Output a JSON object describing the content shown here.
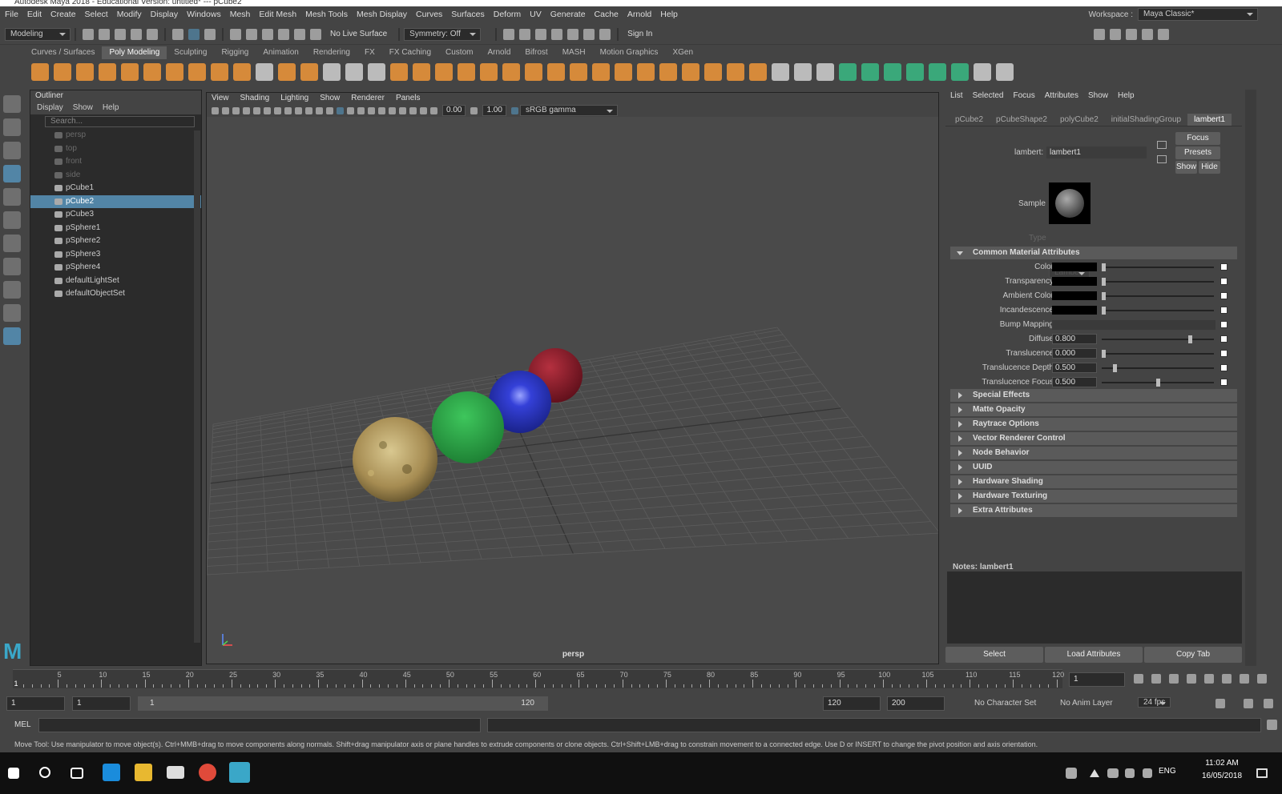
{
  "window": {
    "title": "Autodesk Maya 2018 - Educational Version: untitled*   ---   pCube2"
  },
  "menubar": [
    "File",
    "Edit",
    "Create",
    "Select",
    "Modify",
    "Display",
    "Windows",
    "Mesh",
    "Edit Mesh",
    "Mesh Tools",
    "Mesh Display",
    "Curves",
    "Surfaces",
    "Deform",
    "UV",
    "Generate",
    "Cache",
    "Arnold",
    "Help"
  ],
  "workspace": {
    "label": "Workspace :",
    "value": "Maya Classic*"
  },
  "statusline": {
    "mode": "Modeling",
    "live_surface": "No Live Surface",
    "symmetry": "Symmetry: Off",
    "sign_in": "Sign In"
  },
  "shelf": {
    "tabs": [
      "Curves / Surfaces",
      "Poly Modeling",
      "Sculpting",
      "Rigging",
      "Animation",
      "Rendering",
      "FX",
      "FX Caching",
      "Custom",
      "Arnold",
      "Bifrost",
      "MASH",
      "Motion Graphics",
      "XGen"
    ],
    "active": "Poly Modeling"
  },
  "outliner": {
    "title": "Outliner",
    "menu": [
      "Display",
      "Show",
      "Help"
    ],
    "search_placeholder": "Search...",
    "items": [
      {
        "label": "persp",
        "dim": true
      },
      {
        "label": "top",
        "dim": true
      },
      {
        "label": "front",
        "dim": true
      },
      {
        "label": "side",
        "dim": true
      },
      {
        "label": "pCube1"
      },
      {
        "label": "pCube2",
        "selected": true
      },
      {
        "label": "pCube3"
      },
      {
        "label": "pSphere1"
      },
      {
        "label": "pSphere2"
      },
      {
        "label": "pSphere3"
      },
      {
        "label": "pSphere4"
      },
      {
        "label": "defaultLightSet"
      },
      {
        "label": "defaultObjectSet"
      }
    ]
  },
  "viewport": {
    "menu": [
      "View",
      "Shading",
      "Lighting",
      "Show",
      "Renderer",
      "Panels"
    ],
    "exposure": "0.00",
    "gamma": "1.00",
    "colorspace": "sRGB gamma",
    "camera": "persp"
  },
  "attribute_editor": {
    "menu": [
      "List",
      "Selected",
      "Focus",
      "Attributes",
      "Show",
      "Help"
    ],
    "tabs": [
      "pCube2",
      "pCubeShape2",
      "polyCube2",
      "initialShadingGroup",
      "lambert1"
    ],
    "active_tab": "lambert1",
    "node_label": "lambert:",
    "node_value": "lambert1",
    "buttons": {
      "focus": "Focus",
      "presets": "Presets",
      "show": "Show",
      "hide": "Hide"
    },
    "sample_label": "Sample",
    "type_label": "Type",
    "type_value": "Lambert",
    "common_section": "Common Material Attributes",
    "attributes": [
      {
        "label": "Color",
        "kind": "swatch",
        "slider": 0.0
      },
      {
        "label": "Transparency",
        "kind": "swatch",
        "slider": 0.0
      },
      {
        "label": "Ambient Color",
        "kind": "swatch",
        "slider": 0.0
      },
      {
        "label": "Incandescence",
        "kind": "swatch",
        "slider": 0.0
      },
      {
        "label": "Bump Mapping",
        "kind": "map"
      },
      {
        "label": "Diffuse",
        "kind": "value",
        "value": "0.800",
        "slider": 0.8
      },
      {
        "label": "Translucence",
        "kind": "value",
        "value": "0.000",
        "slider": 0.0
      },
      {
        "label": "Translucence Depth",
        "kind": "value",
        "value": "0.500",
        "slider": 0.1
      },
      {
        "label": "Translucence Focus",
        "kind": "value",
        "value": "0.500",
        "slider": 0.5
      }
    ],
    "sections": [
      "Special Effects",
      "Matte Opacity",
      "Raytrace Options",
      "Vector Renderer Control",
      "Node Behavior",
      "UUID",
      "Hardware Shading",
      "Hardware Texturing",
      "Extra Attributes"
    ],
    "notes_label": "Notes:  lambert1",
    "bottom_buttons": [
      "Select",
      "Load Attributes",
      "Copy Tab"
    ]
  },
  "timeline": {
    "ticks": [
      "5",
      "10",
      "15",
      "20",
      "25",
      "30",
      "35",
      "40",
      "45",
      "50",
      "55",
      "60",
      "65",
      "70",
      "75",
      "80",
      "85",
      "90",
      "95",
      "100",
      "105",
      "110",
      "115",
      "120"
    ],
    "current_frame": "1",
    "current_field": "1"
  },
  "range": {
    "start": "1",
    "playback_start": "1",
    "slider_start": "1",
    "slider_end": "120",
    "playback_end": "120",
    "end": "200",
    "character_set": "No Character Set",
    "anim_layer": "No Anim Layer",
    "fps": "24 fps"
  },
  "command": {
    "lang": "MEL"
  },
  "helpline": "Move Tool: Use manipulator to move object(s). Ctrl+MMB+drag to move components along normals. Shift+drag manipulator axis or plane handles to extrude components or clone objects. Ctrl+Shift+LMB+drag to constrain movement to a connected edge. Use D or INSERT to change the pivot position and axis orientation.",
  "taskbar": {
    "lang": "ENG",
    "time": "11:02 AM",
    "date": "16/05/2018"
  },
  "colors": {
    "accent": "#5285a6",
    "sphere_red": "#9b1e2e",
    "sphere_blue": "#2a34c8",
    "sphere_green": "#2fae4a",
    "shelf_orange": "#d68a3a"
  }
}
